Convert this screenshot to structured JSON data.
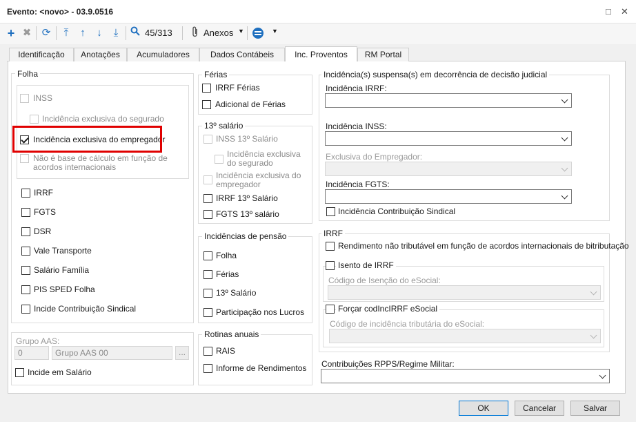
{
  "window": {
    "title": "Evento: <novo> - 03.9.0516",
    "restore_glyph": "□",
    "close_glyph": "✕"
  },
  "toolbar": {
    "record_position": "45/313",
    "attachments_label": "Anexos"
  },
  "tabs": [
    "Identificação",
    "Anotações",
    "Acumuladores",
    "Dados Contábeis",
    "Inc. Proventos",
    "RM Portal"
  ],
  "folha": {
    "title": "Folha",
    "inss": "INSS",
    "inc_segurado": "Incidência exclusiva do segurado",
    "inc_empregador": "Incidência exclusiva do empregador",
    "nao_base_1": "Não é base de cálculo em função de",
    "nao_base_2": "acordos internacionais",
    "items": [
      "IRRF",
      "FGTS",
      "DSR",
      "Vale Transporte",
      "Salário Família",
      "PIS SPED Folha",
      "Incide Contribuição Sindical"
    ]
  },
  "aas": {
    "title": "Grupo AAS:",
    "code": "0",
    "name": "Grupo AAS 00",
    "lookup": "...",
    "incide": "Incide em Salário"
  },
  "ferias": {
    "title": "Férias",
    "items": [
      "IRRF Férias",
      "Adicional de Férias"
    ]
  },
  "decimo": {
    "title": "13º salário",
    "inss": "INSS 13º Salário",
    "seg_1": "Incidência exclusiva",
    "seg_2": "do segurado",
    "emp_1": "Incidência exclusiva do",
    "emp_2": "empregador",
    "irrf": "IRRF 13º Salário",
    "fgts": "FGTS 13º salário"
  },
  "pensao": {
    "title": "Incidências de pensão",
    "items": [
      "Folha",
      "Férias",
      "13º Salário",
      "Participação nos Lucros"
    ]
  },
  "rotinas": {
    "title": "Rotinas anuais",
    "items": [
      "RAIS",
      "Informe de Rendimentos"
    ]
  },
  "suspensa": {
    "title": "Incidência(s) suspensa(s) em decorrência de decisão judicial",
    "irrf": "Incidência IRRF:",
    "inss": "Incidência INSS:",
    "exclusiva": "Exclusiva do Empregador:",
    "fgts": "Incidência FGTS:",
    "sindical": "Incidência Contribuição Sindical"
  },
  "irrf": {
    "title": "IRRF",
    "rendimento": "Rendimento não tributável em função de acordos internacionais de bitributação",
    "isento": "Isento de IRRF",
    "cod_isencao": "Código de Isenção do eSocial:",
    "forcar": "Forçar codIncIRRF eSocial",
    "cod_incidencia": "Código de incidência tributária do eSocial:"
  },
  "rpps": {
    "label": "Contribuições RPPS/Regime Militar:"
  },
  "buttons": {
    "ok": "OK",
    "cancel": "Cancelar",
    "save": "Salvar"
  }
}
